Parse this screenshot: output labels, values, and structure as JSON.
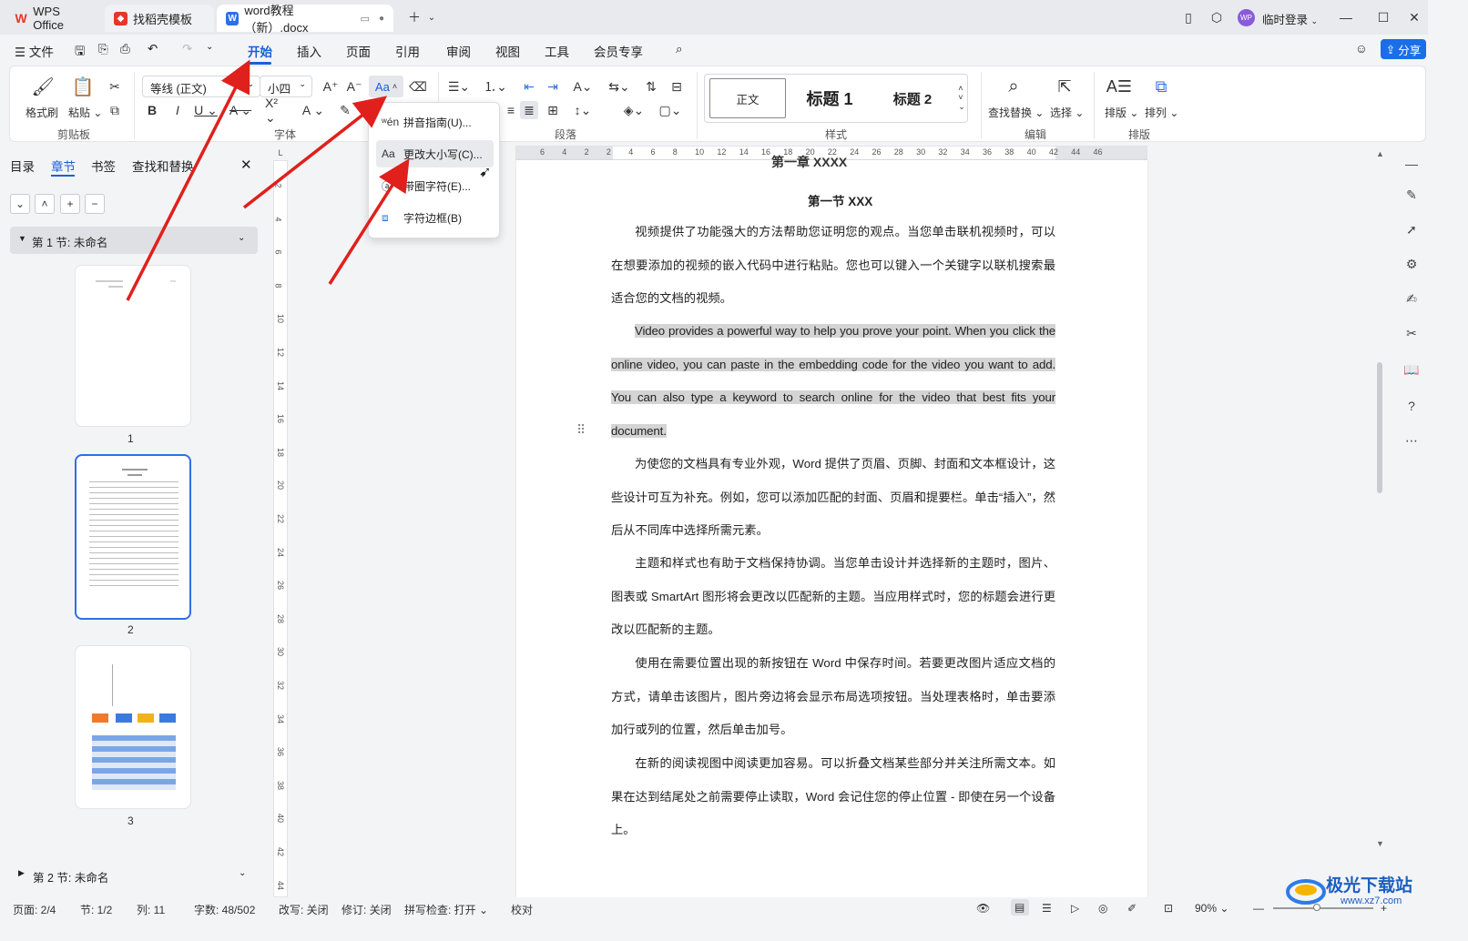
{
  "tabs": {
    "wps": "WPS Office",
    "template": "找稻壳模板",
    "doc": "word教程（新）.docx"
  },
  "user": {
    "avatar": "WP",
    "login": "临时登录"
  },
  "menu": {
    "file": "文件",
    "items": [
      "开始",
      "插入",
      "页面",
      "引用",
      "审阅",
      "视图",
      "工具",
      "会员专享"
    ],
    "share": "分享"
  },
  "ribbon": {
    "format_painter": "格式刷",
    "paste": "粘贴",
    "font_name": "等线 (正文)",
    "font_size": "小四",
    "change_case": "Aa",
    "styles": [
      "正文",
      "标题 1",
      "标题 2"
    ],
    "find_replace": "查找替换",
    "select": "选择",
    "layout": "排版",
    "arrange": "排列",
    "groups": {
      "clipboard": "剪贴板",
      "font": "字体",
      "paragraph": "段落",
      "style": "样式",
      "edit": "编辑",
      "typeset": "排版"
    }
  },
  "dropdown": {
    "items": [
      "拼音指南(U)...",
      "更改大小写(C)...",
      "带圈字符(E)...",
      "字符边框(B)"
    ]
  },
  "nav": {
    "tabs": [
      "目录",
      "章节",
      "书签",
      "查找和替换"
    ],
    "section1": "第 1 节: 未命名",
    "section2": "第 2 节: 未命名",
    "pages": [
      "1",
      "2",
      "3"
    ]
  },
  "ruler": {
    "h_ticks": [
      "6",
      "4",
      "2",
      "2",
      "4",
      "6",
      "8",
      "10",
      "12",
      "14",
      "16",
      "18",
      "20",
      "22",
      "24",
      "26",
      "28",
      "30",
      "32",
      "34",
      "36",
      "38",
      "40",
      "42",
      "44",
      "46"
    ],
    "v_ticks": [
      "2",
      "4",
      "6",
      "8",
      "10",
      "12",
      "14",
      "16",
      "18",
      "20",
      "22",
      "24",
      "26",
      "28",
      "30",
      "32",
      "34",
      "36",
      "38",
      "40",
      "42",
      "44"
    ]
  },
  "document": {
    "chapter_top": "第一章 XXXX",
    "section_title": "第一节 XXX",
    "p1": "视频提供了功能强大的方法帮助您证明您的观点。当您单击联机视频时，可以在想要添加的视频的嵌入代码中进行粘贴。您也可以键入一个关键字以联机搜索最适合您的文档的视频。",
    "p2": "Video provides a powerful way to help you prove your point. When you click the online video, you can paste in the embedding code for the video you want to add. You can also type a keyword to search online for the video that best fits your document.",
    "p3": "为使您的文档具有专业外观，Word 提供了页眉、页脚、封面和文本框设计，这些设计可互为补充。例如，您可以添加匹配的封面、页眉和提要栏。单击“插入”，然后从不同库中选择所需元素。",
    "p4": "主题和样式也有助于文档保持协调。当您单击设计并选择新的主题时，图片、图表或 SmartArt 图形将会更改以匹配新的主题。当应用样式时，您的标题会进行更改以匹配新的主题。",
    "p5": "使用在需要位置出现的新按钮在 Word 中保存时间。若要更改图片适应文档的方式，请单击该图片，图片旁边将会显示布局选项按钮。当处理表格时，单击要添加行或列的位置，然后单击加号。",
    "p6": "在新的阅读视图中阅读更加容易。可以折叠文档某些部分并关注所需文本。如果在达到结尾处之前需要停止读取，Word 会记住您的停止位置 - 即使在另一个设备上。"
  },
  "status": {
    "page": "页面: 2/4",
    "section": "节: 1/2",
    "column": "列: 11",
    "words": "字数: 48/502",
    "overwrite": "改写: 关闭",
    "revise": "修订: 关闭",
    "spell": "拼写检查: 打开",
    "proof": "校对",
    "zoom": "90%"
  },
  "watermark": "极光下载站",
  "watermark_url": "www.xz7.com",
  "colors": {
    "accent": "#1a5fd6",
    "wps_red": "#e8352a",
    "arrow": "#e0201c"
  }
}
